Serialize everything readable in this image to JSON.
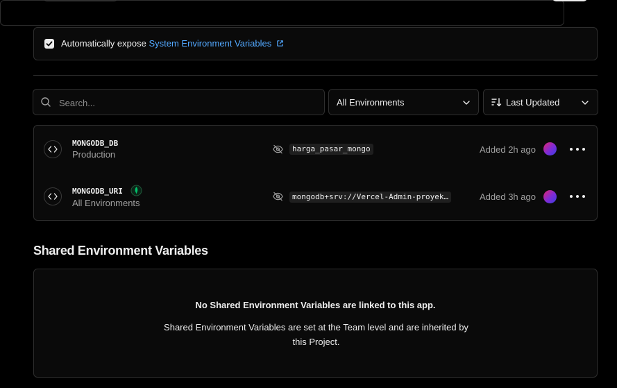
{
  "expose": {
    "checked": true,
    "label": "Automatically expose",
    "link_text": "System Environment Variables"
  },
  "filters": {
    "search_placeholder": "Search...",
    "environment_select": "All Environments",
    "sort_select": "Last Updated"
  },
  "variables": [
    {
      "name": "MONGODB_DB",
      "environment": "Production",
      "value": "harga_pasar_mongo",
      "added": "Added 2h ago",
      "integration_badge": false
    },
    {
      "name": "MONGODB_URI",
      "environment": "All Environments",
      "value": "mongodb+srv://Vercel-Admin-proyek…",
      "added": "Added 3h ago",
      "integration_badge": true
    }
  ],
  "shared": {
    "title": "Shared Environment Variables",
    "empty_title": "No Shared Environment Variables are linked to this app.",
    "empty_description": "Shared Environment Variables are set at the Team level and are inherited by this Project."
  },
  "colors": {
    "link": "#52a8ff",
    "integration_badge": "#00c16a",
    "avatar_gradient": [
      "#e0256f",
      "#7c2bd8",
      "#3a3fe0"
    ]
  },
  "icons": [
    "checkmark-icon",
    "external-link-icon",
    "search-icon",
    "chevron-down-icon",
    "sort-icon",
    "code-icon",
    "eye-off-icon",
    "mongodb-leaf-icon",
    "more-horizontal-icon"
  ]
}
